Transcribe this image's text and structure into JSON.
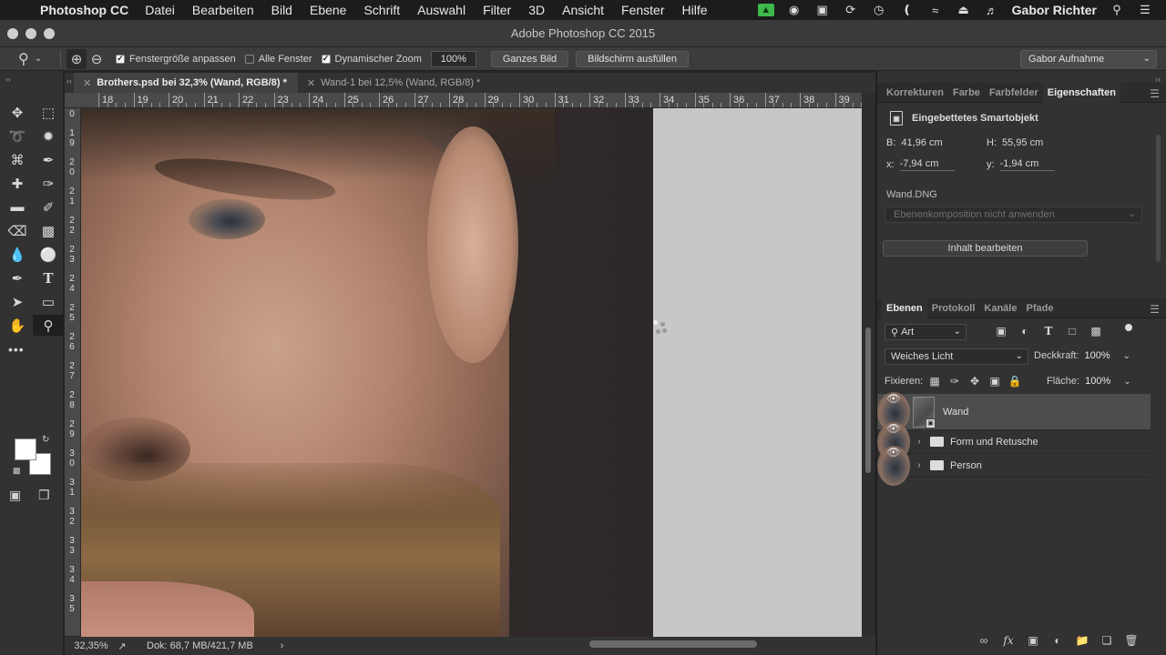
{
  "menubar": {
    "apple_icon": "apple-icon",
    "app_name": "Photoshop CC",
    "items": [
      "Datei",
      "Bearbeiten",
      "Bild",
      "Ebene",
      "Schrift",
      "Auswahl",
      "Filter",
      "3D",
      "Ansicht",
      "Fenster",
      "Hilfe"
    ],
    "user": "Gabor Richter",
    "status_icons": [
      "evernote-icon",
      "screenflow-icon",
      "battery-monitor-icon",
      "sync-icon",
      "time-machine-icon",
      "bluetooth-icon",
      "wifi-icon",
      "eject-icon",
      "volume-icon",
      "search-icon",
      "list-icon"
    ]
  },
  "window": {
    "title": "Adobe Photoshop CC 2015"
  },
  "options": {
    "chk_fit_window": "Fenstergröße anpassen",
    "chk_all_windows": "Alle Fenster",
    "chk_scrubby_zoom": "Dynamischer Zoom",
    "zoom_value": "100%",
    "btn_fit_screen": "Ganzes Bild",
    "btn_fill_screen": "Bildschirm ausfüllen",
    "workspace": "Gabor Aufnahme"
  },
  "tabs": [
    {
      "label": "Brothers.psd bei 32,3% (Wand, RGB/8) *",
      "active": true
    },
    {
      "label": "Wand-1 bei 12,5% (Wand, RGB/8) *",
      "active": false
    }
  ],
  "ruler": {
    "top": [
      "18",
      "19",
      "20",
      "21",
      "22",
      "23",
      "24",
      "25",
      "26",
      "27",
      "28",
      "29",
      "30",
      "31",
      "32",
      "33",
      "34",
      "35",
      "36",
      "37",
      "38",
      "39"
    ],
    "left": [
      [
        "0"
      ],
      [
        "1",
        "9"
      ],
      [
        "2",
        "0"
      ],
      [
        "2",
        "1"
      ],
      [
        "2",
        "2"
      ],
      [
        "2",
        "3"
      ],
      [
        "2",
        "4"
      ],
      [
        "2",
        "5"
      ],
      [
        "2",
        "6"
      ],
      [
        "2",
        "7"
      ],
      [
        "2",
        "8"
      ],
      [
        "2",
        "9"
      ],
      [
        "3",
        "0"
      ],
      [
        "3",
        "1"
      ],
      [
        "3",
        "2"
      ],
      [
        "3",
        "3"
      ],
      [
        "3",
        "4"
      ],
      [
        "3",
        "5"
      ]
    ]
  },
  "status": {
    "zoom": "32,35%",
    "doc": "Dok: 68,7 MB/421,7 MB"
  },
  "properties": {
    "tabs": [
      "Korrekturen",
      "Farbe",
      "Farbfelder",
      "Eigenschaften"
    ],
    "title": "Eingebettetes Smartobjekt",
    "w_label": "B:",
    "w_value": "41,96 cm",
    "h_label": "H:",
    "h_value": "55,95 cm",
    "x_label": "x:",
    "x_value": "-7,94 cm",
    "y_label": "y:",
    "y_value": "-1,94 cm",
    "file": "Wand.DNG",
    "comp_placeholder": "Ebenenkomposition nicht anwenden",
    "edit_button": "Inhalt bearbeiten"
  },
  "layers": {
    "tabs": [
      "Ebenen",
      "Protokoll",
      "Kanäle",
      "Pfade"
    ],
    "filter": "Art",
    "blend_mode": "Weiches Licht",
    "opacity_label": "Deckkraft:",
    "opacity_value": "100%",
    "lock_label": "Fixieren:",
    "fill_label": "Fläche:",
    "fill_value": "100%",
    "items": [
      {
        "name": "Wand",
        "type": "smart-object",
        "selected": true
      },
      {
        "name": "Form und Retusche",
        "type": "group",
        "selected": false
      },
      {
        "name": "Person",
        "type": "group",
        "selected": false
      }
    ]
  }
}
